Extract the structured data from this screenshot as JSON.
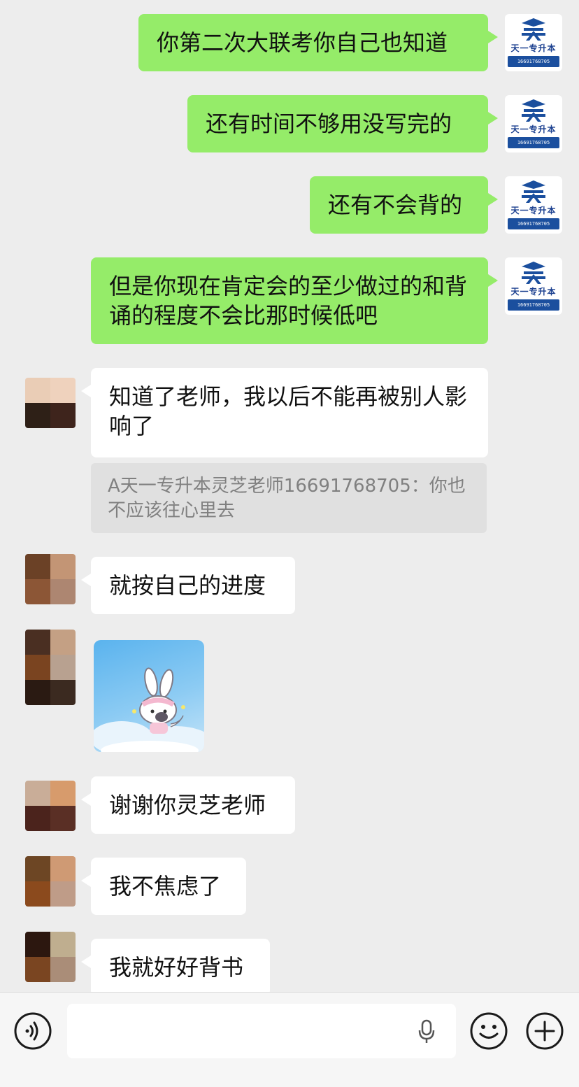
{
  "messages": [
    {
      "direction": "outgoing",
      "text": "你第二次大联考你自己也知道"
    },
    {
      "direction": "outgoing",
      "text": "还有时间不够用没写完的"
    },
    {
      "direction": "outgoing",
      "text": "还有不会背的"
    },
    {
      "direction": "outgoing",
      "text": "但是你现在肯定会的至少做过的和背诵的程度不会比那时候低吧"
    },
    {
      "direction": "incoming",
      "text": "知道了老师，我以后不能再被别人影响了"
    },
    {
      "direction": "incoming",
      "text": "就按自己的进度"
    },
    {
      "direction": "incoming",
      "type": "sticker",
      "sticker": "bunny-cloud-sticker"
    },
    {
      "direction": "incoming",
      "text": "谢谢你灵芝老师"
    },
    {
      "direction": "incoming",
      "text": "我不焦虑了"
    },
    {
      "direction": "incoming",
      "text": "我就好好背书"
    }
  ],
  "quote": {
    "text": "A天一专升本灵芝老师16691768705：你也不应该往心里去"
  },
  "brand_avatar": {
    "name": "天一专升本",
    "phone": "16691768705",
    "color": "#1b4f9e"
  },
  "colors": {
    "outgoing_bubble": "#95ec69",
    "incoming_bubble": "#ffffff",
    "background": "#ededed"
  },
  "toolbar": {
    "voice_icon": "voice-icon",
    "input_value": "",
    "mic_icon": "microphone-icon",
    "emoji_icon": "emoji-icon",
    "plus_icon": "plus-icon"
  },
  "mosaics": [
    [
      "#eacdb6",
      "#efd2bd",
      "#2e2017",
      "#3e241c"
    ],
    [
      "#6b4126",
      "#c39575",
      "#8c5636",
      "#ad8671"
    ],
    [
      "#4a2f22",
      "#c4a084",
      "#7a4420",
      "#b8a190",
      "#2a1a12",
      "#3b2a20"
    ],
    [
      "#c9ad98",
      "#d79b6c",
      "#4b231c",
      "#5a2f25"
    ],
    [
      "#6d4624",
      "#cf9a74",
      "#8b4a1d",
      "#bf9c88"
    ],
    [
      "#2c170f",
      "#bfae8f",
      "#7a4521",
      "#aa8d78"
    ]
  ]
}
